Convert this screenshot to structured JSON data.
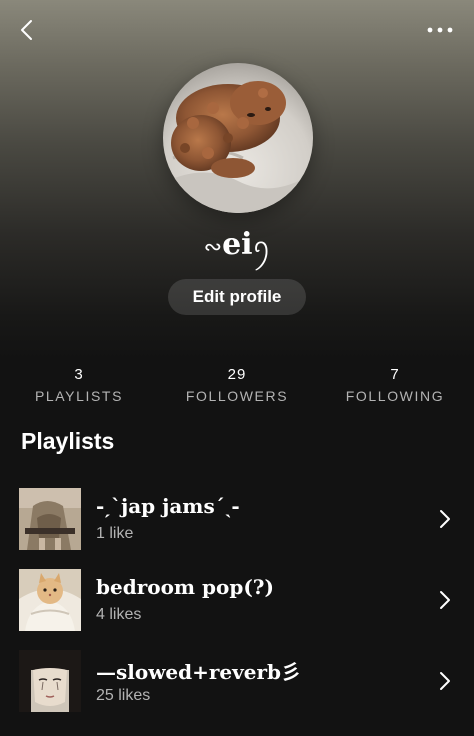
{
  "colors": {
    "background": "#121212",
    "header_gradient_top": "#8a887b",
    "text_primary": "#ffffff",
    "text_secondary": "#b3b3b3",
    "button_bg": "rgba(255,255,255,0.13)"
  },
  "topbar": {
    "back_icon": "chevron-left-icon",
    "more_icon": "more-horizontal-icon"
  },
  "profile": {
    "avatar_icon": "dog-photo",
    "username": "ei",
    "edit_label": "Edit profile"
  },
  "stats": [
    {
      "count": "3",
      "label": "PLAYLISTS"
    },
    {
      "count": "29",
      "label": "FOLLOWERS"
    },
    {
      "count": "7",
      "label": "FOLLOWING"
    }
  ],
  "playlists_section": {
    "title": "Playlists",
    "items": [
      {
        "name": "-ˏˋjap jamsˊˎ-",
        "likes": "1 like"
      },
      {
        "name": " bedroom pop(?)",
        "likes": "4 likes"
      },
      {
        "name": "—slowed+reverb彡",
        "likes": "25 likes"
      }
    ]
  }
}
